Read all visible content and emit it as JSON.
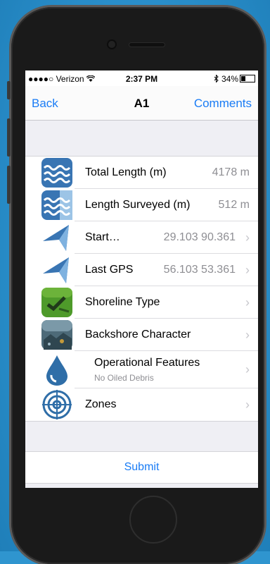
{
  "status_bar": {
    "carrier": "●●●●○ Verizon ",
    "time": "2:37 PM",
    "battery": "34%"
  },
  "nav": {
    "back": "Back",
    "title": "A1",
    "comments": "Comments"
  },
  "rows": [
    {
      "label": "Total Length (m)",
      "value": "4178 m",
      "icon": "waves-icon"
    },
    {
      "label": "Length Surveyed (m)",
      "value": "512 m",
      "icon": "waves-measure-icon"
    },
    {
      "label": "Start…",
      "value": "29.103 90.361",
      "icon": "arrow-location-icon"
    },
    {
      "label": "Last GPS",
      "value": "56.103 53.361",
      "icon": "arrow-location-icon"
    },
    {
      "label": "Shoreline Type",
      "icon": "shoreline-photo-icon"
    },
    {
      "label": "Backshore Character",
      "icon": "backshore-photo-icon"
    },
    {
      "label": "Operational Features",
      "subtitle": "No Oiled Debris",
      "icon": "oil-drop-icon"
    },
    {
      "label": "Zones",
      "icon": "target-icon"
    }
  ],
  "submit": "Submit",
  "colors": {
    "accent": "#1a7cf5",
    "icon_blue": "#3d7fbf",
    "background": "#2f95cf"
  }
}
